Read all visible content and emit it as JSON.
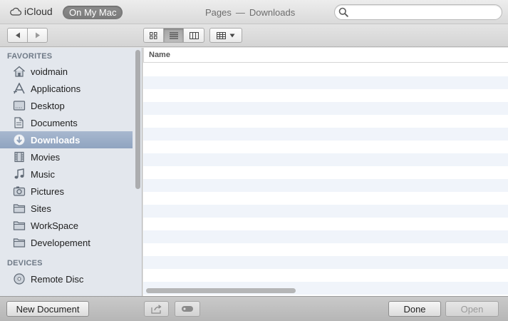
{
  "header": {
    "icloud_label": "iCloud",
    "onmymac_label": "On My Mac",
    "app_name": "Pages",
    "separator": "—",
    "location": "Downloads",
    "search": {
      "value": "",
      "placeholder": ""
    }
  },
  "sidebar": {
    "favorites_heading": "FAVORITES",
    "devices_heading": "DEVICES",
    "favorites": [
      {
        "label": "voidmain",
        "icon": "home-icon"
      },
      {
        "label": "Applications",
        "icon": "applications-icon"
      },
      {
        "label": "Desktop",
        "icon": "desktop-icon"
      },
      {
        "label": "Documents",
        "icon": "documents-icon"
      },
      {
        "label": "Downloads",
        "icon": "downloads-icon",
        "selected": true
      },
      {
        "label": "Movies",
        "icon": "movies-icon"
      },
      {
        "label": "Music",
        "icon": "music-icon"
      },
      {
        "label": "Pictures",
        "icon": "pictures-icon"
      },
      {
        "label": "Sites",
        "icon": "folder-icon"
      },
      {
        "label": "WorkSpace",
        "icon": "folder-icon"
      },
      {
        "label": "Developement",
        "icon": "folder-icon"
      }
    ],
    "devices": [
      {
        "label": "Remote Disc",
        "icon": "disc-icon"
      }
    ]
  },
  "filelist": {
    "column_name": "Name"
  },
  "footer": {
    "new_document": "New Document",
    "done": "Done",
    "open": "Open"
  },
  "colors": {
    "sidebar_bg": "#e3e7ed",
    "selection": "#95a8c3",
    "row_stripe": "#f0f4fa"
  }
}
